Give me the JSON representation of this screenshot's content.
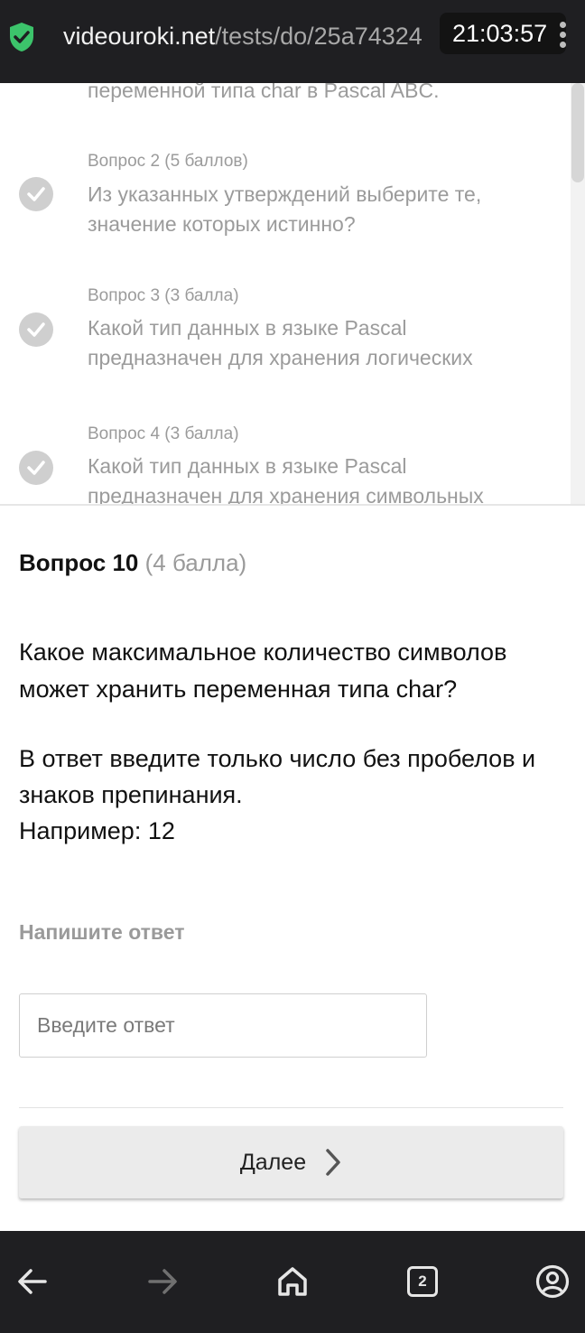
{
  "browser": {
    "url_host": "videouroki.net",
    "url_path": "/tests/do/25a74324",
    "clock": "21:03:57",
    "colors": {
      "bar_bg": "#1f1f22",
      "shield": "#3cc36b"
    }
  },
  "question_list": {
    "partial_text": "переменной типа char в Pascal ABC.",
    "items": [
      {
        "header": "Вопрос 2 (5 баллов)",
        "text": "Из указанных утверждений выберите те, значение которых истинно?",
        "icon": "check-circle-icon"
      },
      {
        "header": "Вопрос 3 (3 балла)",
        "text": "Какой тип данных в языке Pascal предназначен для хранения логических",
        "icon": "check-circle-icon"
      },
      {
        "header": "Вопрос 4 (3 балла)",
        "text": "Какой тип данных в языке Pascal предназначен для хранения символьных",
        "icon": "check-circle-icon"
      }
    ]
  },
  "current_question": {
    "number_label": "Вопрос 10",
    "points_label": "(4 балла)",
    "text": "Какое максимальное количество символов может хранить переменная типа char?",
    "instruction_line1": "В ответ введите только число без пробелов и знаков препинания.",
    "instruction_line2": "Например: 12"
  },
  "answer": {
    "label": "Напишите ответ",
    "placeholder": "Введите ответ",
    "value": ""
  },
  "next_button": {
    "label": "Далее"
  },
  "navbar": {
    "tabs_count": "2",
    "icons": [
      "back-arrow-icon",
      "forward-arrow-icon",
      "home-icon",
      "tabs-icon",
      "account-icon"
    ]
  }
}
